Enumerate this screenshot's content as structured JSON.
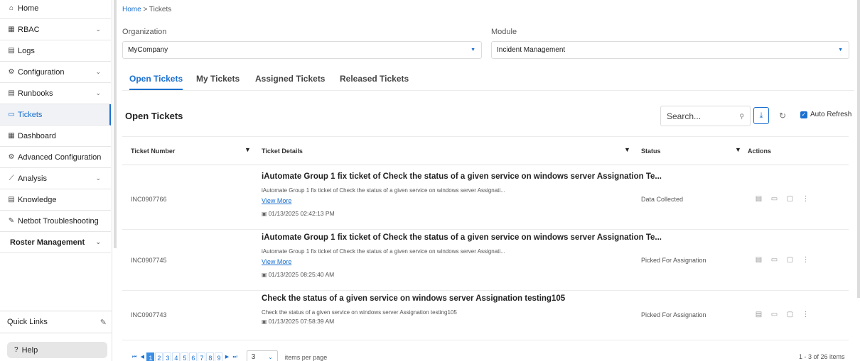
{
  "sidebar": {
    "items": [
      {
        "label": "Home",
        "icon": "⌂",
        "chevron": ""
      },
      {
        "label": "RBAC",
        "icon": "▦",
        "chevron": "⌄"
      },
      {
        "label": "Logs",
        "icon": "▤",
        "chevron": ""
      },
      {
        "label": "Configuration",
        "icon": "⚙",
        "chevron": "⌄"
      },
      {
        "label": "Runbooks",
        "icon": "▤",
        "chevron": "⌄"
      },
      {
        "label": "Tickets",
        "icon": "▭",
        "chevron": ""
      },
      {
        "label": "Dashboard",
        "icon": "▦",
        "chevron": ""
      },
      {
        "label": "Advanced Configuration",
        "icon": "⚙",
        "chevron": ""
      },
      {
        "label": "Analysis",
        "icon": "⟋",
        "chevron": "⌄"
      },
      {
        "label": "Knowledge",
        "icon": "▤",
        "chevron": ""
      },
      {
        "label": "Netbot Troubleshooting",
        "icon": "✎",
        "chevron": ""
      },
      {
        "label": "Roster Management",
        "icon": "",
        "chevron": "⌄"
      }
    ],
    "quick_links": "Quick Links",
    "help": "Help"
  },
  "breadcrumb": {
    "home": "Home",
    "sep": ">",
    "current": "Tickets"
  },
  "filters": {
    "organization_label": "Organization",
    "organization_value": "MyCompany",
    "module_label": "Module",
    "module_value": "Incident Management"
  },
  "tabs": [
    "Open Tickets",
    "My Tickets",
    "Assigned Tickets",
    "Released Tickets"
  ],
  "section": {
    "title": "Open Tickets",
    "search_placeholder": "Search...",
    "auto_refresh": "Auto Refresh"
  },
  "table": {
    "headers": {
      "number": "Ticket Number",
      "details": "Ticket Details",
      "status": "Status",
      "actions": "Actions"
    },
    "rows": [
      {
        "number": "INC0907766",
        "title": "iAutomate Group 1 fix ticket of Check the status of a given service on windows server Assignation Te...",
        "desc": "iAutomate Group 1 fix ticket of Check the status of a given service on windows server Assignati...",
        "more": "View More",
        "date": "01/13/2025 02:42:13 PM",
        "status": "Data Collected"
      },
      {
        "number": "INC0907745",
        "title": "iAutomate Group 1 fix ticket of Check the status of a given service on windows server Assignation Te...",
        "desc": "iAutomate Group 1 fix ticket of Check the status of a given service on windows server Assignati...",
        "more": "View More",
        "date": "01/13/2025 08:25:40 AM",
        "status": "Picked For Assignation"
      },
      {
        "number": "INC0907743",
        "title": "Check the status of a given service on windows server Assignation testing105",
        "desc": "Check the status of a given service on windows server Assignation testing105",
        "more": "",
        "date": "01/13/2025 07:58:39 AM",
        "status": "Picked For Assignation"
      }
    ]
  },
  "pagination": {
    "pages": [
      "1",
      "2",
      "3",
      "4",
      "5",
      "6",
      "7",
      "8",
      "9"
    ],
    "current_page": "1",
    "page_size": "3",
    "items_per_page": "items per page",
    "count": "1 - 3 of 26 items"
  },
  "colors": {
    "accent": "#1a6fd0",
    "active_page": "#3a8ee6"
  }
}
